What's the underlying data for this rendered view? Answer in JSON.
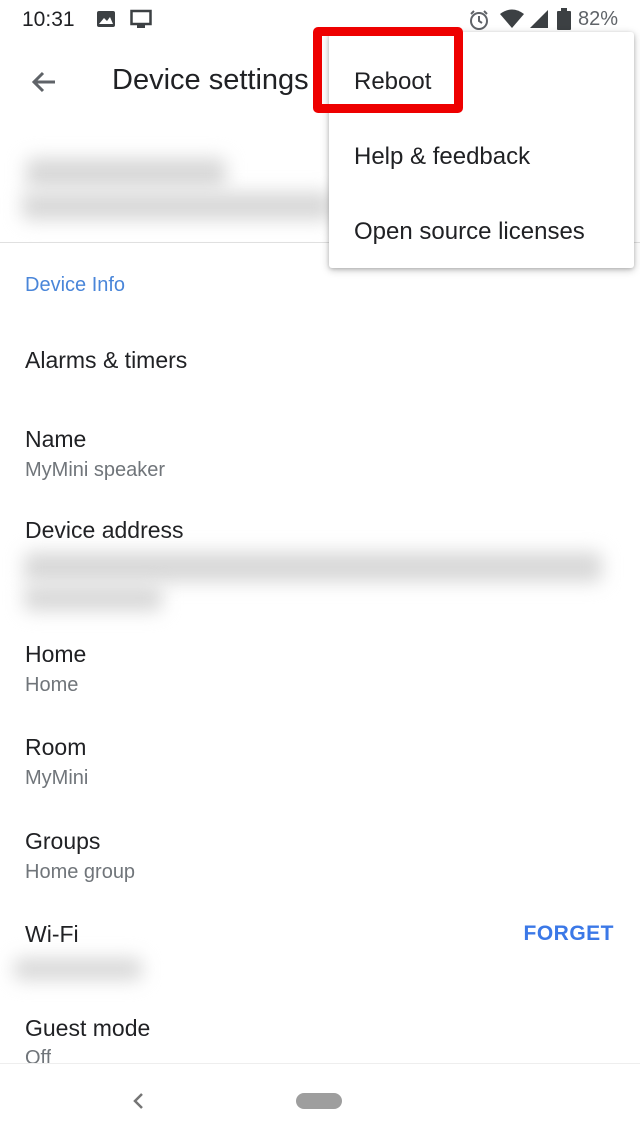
{
  "status_bar": {
    "time": "10:31",
    "battery": "82%",
    "icons": [
      "image-icon",
      "cast-icon",
      "alarm-icon",
      "wifi-icon",
      "signal-icon",
      "battery-icon"
    ]
  },
  "app_bar": {
    "title": "Device settings",
    "back_icon": "arrow-back-icon"
  },
  "overflow_menu": {
    "items": [
      {
        "label": "Reboot"
      },
      {
        "label": "Help & feedback"
      },
      {
        "label": "Open source licenses"
      }
    ],
    "highlight_color": "#ee0000"
  },
  "content": {
    "section_header": "Device Info",
    "alarms": {
      "label": "Alarms & timers"
    },
    "name": {
      "label": "Name",
      "value": "MyMini speaker"
    },
    "device_address": {
      "label": "Device address"
    },
    "home": {
      "label": "Home",
      "value": "Home"
    },
    "room": {
      "label": "Room",
      "value": "MyMini"
    },
    "groups": {
      "label": "Groups",
      "value": "Home group"
    },
    "wifi": {
      "label": "Wi-Fi",
      "action": "FORGET"
    },
    "guest_mode": {
      "label": "Guest mode",
      "value": "Off"
    }
  },
  "colors": {
    "accent": "#4a86d9",
    "forget": "#3b78e7"
  }
}
